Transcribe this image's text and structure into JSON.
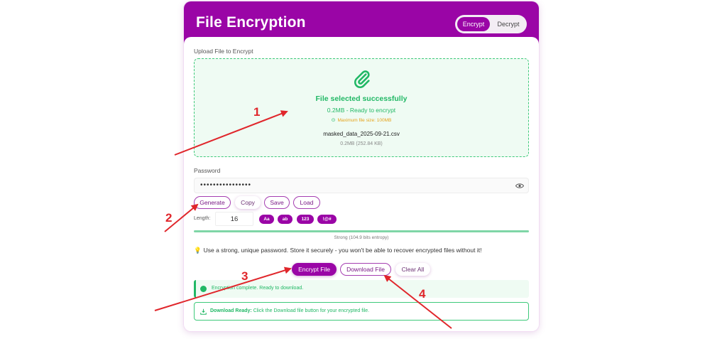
{
  "app": {
    "title": "File Encryption",
    "modes": {
      "encrypt": "Encrypt",
      "decrypt": "Decrypt",
      "active": "Encrypt"
    }
  },
  "upload": {
    "label": "Upload File to Encrypt",
    "icon": "paperclip-icon",
    "status": "File selected successfully",
    "ready_text": "0.2MB - Ready to encrypt",
    "max_size": "Maximum file size: 100MB",
    "file_name": "masked_data_2025-09-21.csv",
    "file_size": "0.2MB (252.84 KB)"
  },
  "password": {
    "label": "Password",
    "value": "••••••••••••••••",
    "icon": "eye-icon",
    "buttons": {
      "generate": "Generate",
      "copy": "Copy",
      "save": "Save",
      "load": "Load"
    },
    "length_label": "Length:",
    "length_value": "16",
    "charset_chips": {
      "upper": "Aa",
      "lower": "ab",
      "digits": "123",
      "symbols": "!@#"
    },
    "strength_fraction": 1.0,
    "strength_text": "Strong (104.9 bits entropy)"
  },
  "tip": {
    "icon": "lightbulb-icon",
    "text": "Use a strong, unique password. Store it securely - you won't be able to recover encrypted files without it!"
  },
  "actions": {
    "encrypt": "Encrypt File",
    "download": "Download File",
    "clear": "Clear All"
  },
  "status": {
    "message": "Encryption complete. Ready to download.",
    "ready_title": "Download Ready:",
    "ready_text": "Click the Download file button for your encrypted file."
  },
  "annotations": [
    "1",
    "2",
    "3",
    "4"
  ],
  "colors": {
    "brand": "#9a05a6",
    "success": "#21b865",
    "warning": "#e5a31b",
    "annotation": "#e0262b"
  }
}
